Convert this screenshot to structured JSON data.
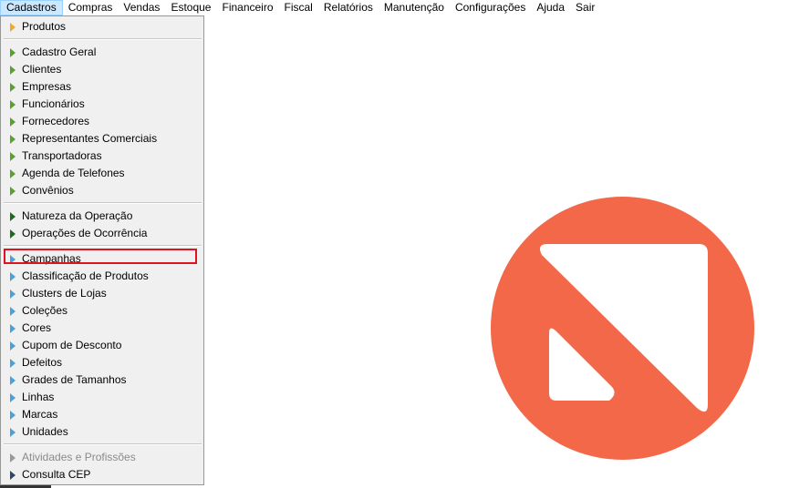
{
  "menubar": {
    "items": [
      "Cadastros",
      "Compras",
      "Vendas",
      "Estoque",
      "Financeiro",
      "Fiscal",
      "Relatórios",
      "Manutenção",
      "Configurações",
      "Ajuda",
      "Sair"
    ],
    "active": "Cadastros"
  },
  "dropdown": {
    "items": [
      {
        "label": "Produtos",
        "icon": "orange-triangle-icon",
        "color": "#f0a830"
      },
      {
        "label": "Cadastro Geral",
        "icon": "green-triangle-icon",
        "color": "#5aa02c"
      },
      {
        "label": "Clientes",
        "icon": "green-triangle-icon",
        "color": "#5aa02c"
      },
      {
        "label": "Empresas",
        "icon": "green-triangle-icon",
        "color": "#5aa02c"
      },
      {
        "label": "Funcionários",
        "icon": "green-triangle-icon",
        "color": "#5aa02c"
      },
      {
        "label": "Fornecedores",
        "icon": "green-triangle-icon",
        "color": "#5aa02c"
      },
      {
        "label": "Representantes Comerciais",
        "icon": "green-triangle-icon",
        "color": "#5aa02c"
      },
      {
        "label": "Transportadoras",
        "icon": "green-triangle-icon",
        "color": "#5aa02c"
      },
      {
        "label": "Agenda de Telefones",
        "icon": "green-triangle-icon",
        "color": "#5aa02c"
      },
      {
        "label": "Convênios",
        "icon": "green-triangle-icon",
        "color": "#5aa02c"
      },
      {
        "label": "Natureza da Operação",
        "icon": "dark-green-triangle-icon",
        "color": "#1e6b1e"
      },
      {
        "label": "Operações de Ocorrência",
        "icon": "dark-green-triangle-icon",
        "color": "#1e6b1e"
      },
      {
        "label": "Campanhas",
        "icon": "blue-triangle-icon",
        "color": "#4aa0d8"
      },
      {
        "label": "Classificação de Produtos",
        "icon": "blue-triangle-icon",
        "color": "#4aa0d8"
      },
      {
        "label": "Clusters de Lojas",
        "icon": "blue-triangle-icon",
        "color": "#4aa0d8"
      },
      {
        "label": "Coleções",
        "icon": "blue-triangle-icon",
        "color": "#4aa0d8"
      },
      {
        "label": "Cores",
        "icon": "blue-triangle-icon",
        "color": "#4aa0d8"
      },
      {
        "label": "Cupom de Desconto",
        "icon": "blue-triangle-icon",
        "color": "#4aa0d8"
      },
      {
        "label": "Defeitos",
        "icon": "blue-triangle-icon",
        "color": "#4aa0d8"
      },
      {
        "label": "Grades de Tamanhos",
        "icon": "blue-triangle-icon",
        "color": "#4aa0d8"
      },
      {
        "label": "Linhas",
        "icon": "blue-triangle-icon",
        "color": "#4aa0d8"
      },
      {
        "label": "Marcas",
        "icon": "blue-triangle-icon",
        "color": "#4aa0d8"
      },
      {
        "label": "Unidades",
        "icon": "blue-triangle-icon",
        "color": "#4aa0d8"
      },
      {
        "label": "Atividades e Profissões",
        "icon": "gray-triangle-icon",
        "color": "#9a9a9a",
        "disabled": true
      },
      {
        "label": "Consulta CEP",
        "icon": "dark-blue-triangle-icon",
        "color": "#2a4a6a"
      }
    ],
    "highlighted": "Campanhas"
  },
  "colors": {
    "logo": "#f26849",
    "highlight_border": "#e0141e",
    "menu_active_bg": "#cce8ff"
  }
}
